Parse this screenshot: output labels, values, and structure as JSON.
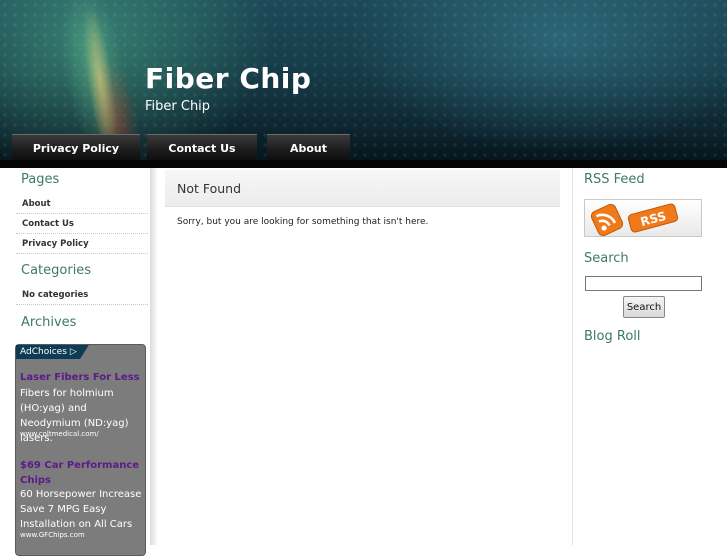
{
  "site": {
    "title": "Fiber Chip",
    "tagline": "Fiber Chip"
  },
  "nav": [
    {
      "label": "Privacy Policy"
    },
    {
      "label": "Contact Us"
    },
    {
      "label": "About"
    }
  ],
  "left_sidebar": {
    "pages_heading": "Pages",
    "pages": [
      {
        "label": "About"
      },
      {
        "label": "Contact Us"
      },
      {
        "label": "Privacy Policy"
      }
    ],
    "categories_heading": "Categories",
    "categories": [
      {
        "label": "No categories"
      }
    ],
    "archives_heading": "Archives",
    "ads": {
      "adchoices_label": "AdChoices",
      "items": [
        {
          "title": "Laser Fibers For Less",
          "body": "Fibers for holmium (HO:yag) and Neodymium (ND:yag) lasers.",
          "url": "www.coltmedical.com/"
        },
        {
          "title": "$69 Car Performance Chips",
          "body": "60 Horsepower Increase Save 7 MPG Easy Installation on All Cars",
          "url": "www.GFChips.com"
        }
      ]
    }
  },
  "main": {
    "title": "Not Found",
    "message": "Sorry, but you are looking for something that isn't here."
  },
  "right_sidebar": {
    "rss_heading": "RSS Feed",
    "rss_badge": "RSS",
    "search_heading": "Search",
    "search_value": "",
    "search_button": "Search",
    "blogroll_heading": "Blog Roll"
  },
  "colors": {
    "heading_green": "#3f7a62",
    "ad_title_purple": "#5c1a8a",
    "rss_orange": "#f07a1a"
  }
}
